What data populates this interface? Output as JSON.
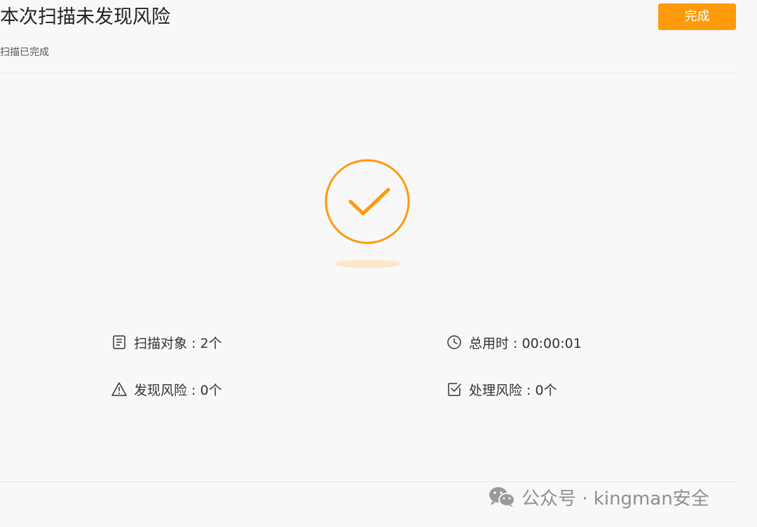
{
  "header": {
    "title": "本次扫描未发现风险",
    "subtitle": "扫描已完成",
    "done_label": "完成"
  },
  "colors": {
    "accent": "#ff9a0a",
    "shadow": "#fde3bd",
    "text": "#333333"
  },
  "result": {
    "icon": "checkmark-circle-icon"
  },
  "stats": {
    "objects": {
      "icon": "document-icon",
      "text": "扫描对象 : 2个"
    },
    "time": {
      "icon": "clock-icon",
      "text": "总用时 : 00:00:01"
    },
    "found": {
      "icon": "warning-icon",
      "text": "发现风险 : 0个"
    },
    "handled": {
      "icon": "check-square-icon",
      "text": "处理风险 : 0个"
    }
  },
  "watermark": {
    "icon": "wechat-icon",
    "text": "公众号 · kingman安全"
  }
}
